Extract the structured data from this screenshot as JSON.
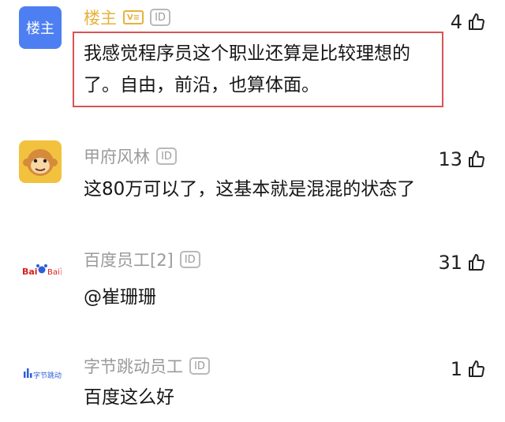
{
  "comments": [
    {
      "avatar_text": "楼主",
      "name": "楼主",
      "vip_badge": "V≡",
      "id_badge": "ID",
      "likes": "4",
      "text_lines": [
        "我感觉程序员这个职业还算是比较理想的",
        "了。自由，前沿，也算体面。"
      ]
    },
    {
      "name": "甲府风林",
      "id_badge": "ID",
      "likes": "13",
      "text_lines": [
        "这80万可以了，这基本就是混混的状态了"
      ]
    },
    {
      "avatar_text": "Bai百度",
      "name": "百度员工[2]",
      "id_badge": "ID",
      "likes": "31",
      "text_lines": [
        "@崔珊珊"
      ]
    },
    {
      "avatar_text": "字节跳动",
      "name": "字节跳动员工",
      "id_badge": "ID",
      "likes": "1",
      "text_lines": [
        "百度这么好"
      ]
    }
  ],
  "colors": {
    "owner_name": "#e7b23c",
    "muted_name": "#9a9a9a",
    "highlight_border": "#d95353",
    "owner_avatar": "#4e7ff2"
  }
}
